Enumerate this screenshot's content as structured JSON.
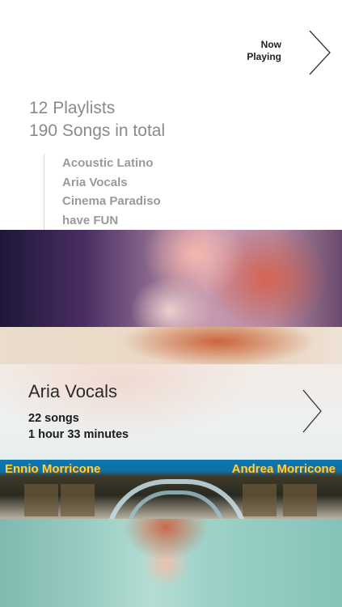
{
  "now_playing": {
    "line1": "Now",
    "line2": "Playing"
  },
  "summary": {
    "playlists": "12 Playlists",
    "songs": "190 Songs in total"
  },
  "playlists": [
    {
      "label": "Acoustic Latino"
    },
    {
      "label": "Aria Vocals"
    },
    {
      "label": "Cinema Paradiso"
    },
    {
      "label": "have FUN"
    }
  ],
  "featured": {
    "title": "Aria Vocals",
    "songs": "22 songs",
    "duration": "1 hour 33 minutes"
  },
  "album": {
    "left_text": "Ennio Morricone",
    "right_text": "Andrea Morricone"
  },
  "icons": {
    "now_playing": "chevron-right-icon",
    "featured": "chevron-right-icon"
  }
}
